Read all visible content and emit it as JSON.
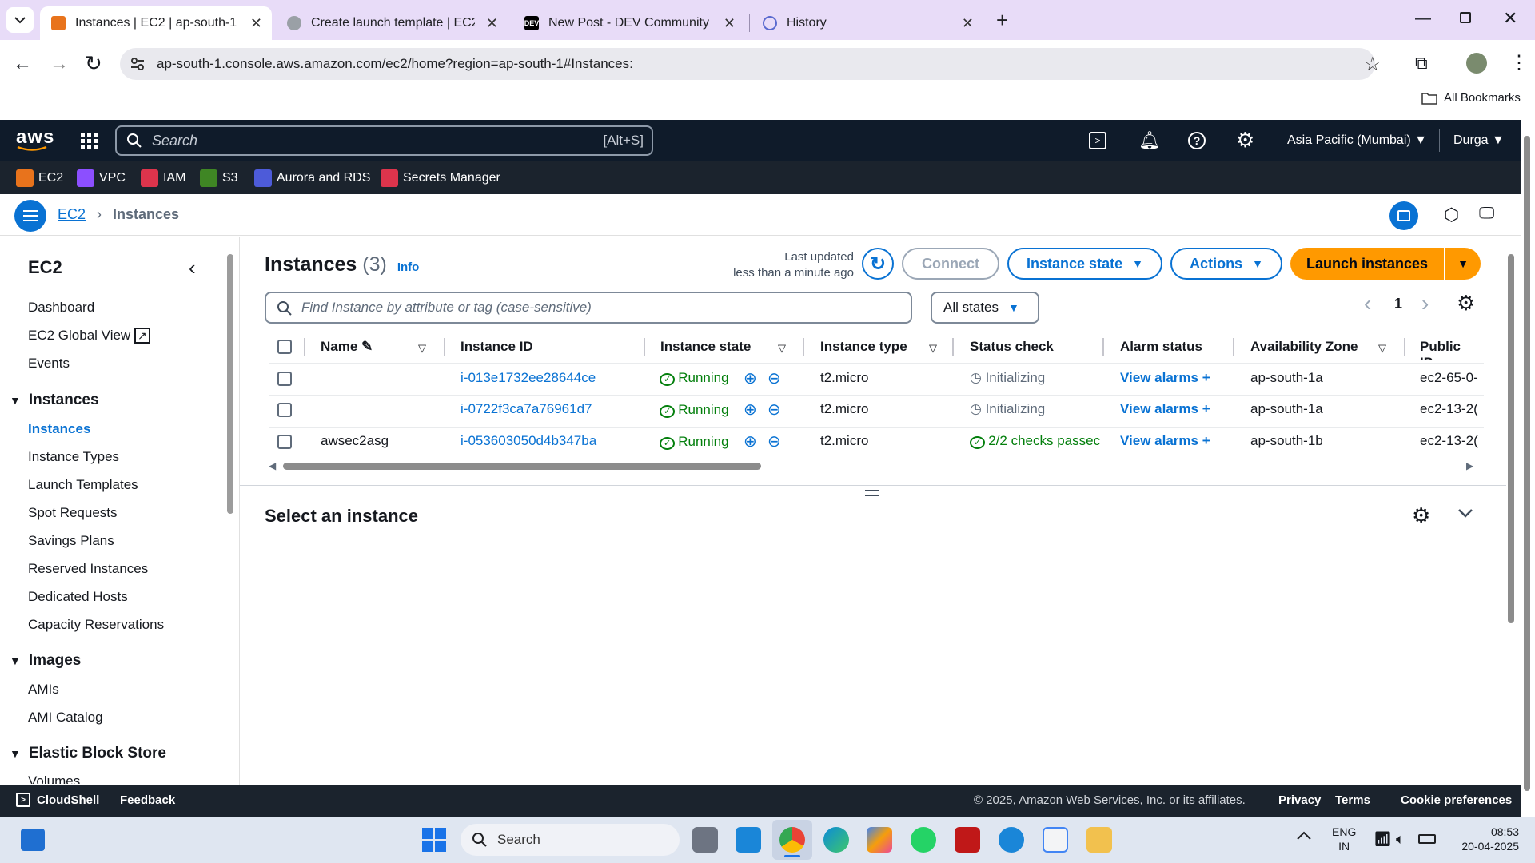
{
  "browser": {
    "tabs": [
      {
        "title": "Instances | EC2 | ap-south-1"
      },
      {
        "title": "Create launch template | EC2 | a"
      },
      {
        "title": "New Post - DEV Community"
      },
      {
        "title": "History"
      }
    ],
    "url": "ap-south-1.console.aws.amazon.com/ec2/home?region=ap-south-1#Instances:",
    "bookmarks_label": "All Bookmarks",
    "dev_badge": "DEV"
  },
  "aws_nav": {
    "logo": "aws",
    "search_placeholder": "Search",
    "search_shortcut": "[Alt+S]",
    "region": "Asia Pacific (Mumbai)",
    "user": "Durga",
    "favorites": [
      {
        "label": "EC2",
        "color": "#e8731c"
      },
      {
        "label": "VPC",
        "color": "#8c4fff"
      },
      {
        "label": "IAM",
        "color": "#dd344c"
      },
      {
        "label": "S3",
        "color": "#3f8624"
      },
      {
        "label": "Aurora and RDS",
        "color": "#4d5bd9"
      },
      {
        "label": "Secrets Manager",
        "color": "#dd344c"
      }
    ]
  },
  "breadcrumb": {
    "root": "EC2",
    "current": "Instances"
  },
  "sidebar": {
    "title": "EC2",
    "top_links": [
      "Dashboard",
      "EC2 Global View",
      "Events"
    ],
    "sections": [
      {
        "title": "Instances",
        "items": [
          "Instances",
          "Instance Types",
          "Launch Templates",
          "Spot Requests",
          "Savings Plans",
          "Reserved Instances",
          "Dedicated Hosts",
          "Capacity Reservations"
        ]
      },
      {
        "title": "Images",
        "items": [
          "AMIs",
          "AMI Catalog"
        ]
      },
      {
        "title": "Elastic Block Store",
        "items": [
          "Volumes"
        ]
      }
    ]
  },
  "main": {
    "title": "Instances",
    "count": "(3)",
    "info": "Info",
    "last_updated_1": "Last updated",
    "last_updated_2": "less than a minute ago",
    "buttons": {
      "connect": "Connect",
      "instance_state": "Instance state",
      "actions": "Actions",
      "launch": "Launch instances"
    },
    "filter_placeholder": "Find Instance by attribute or tag (case-sensitive)",
    "states_filter": "All states",
    "page": "1",
    "columns": [
      "Name",
      "Instance ID",
      "Instance state",
      "Instance type",
      "Status check",
      "Alarm status",
      "Availability Zone",
      "Public IPv"
    ],
    "rows": [
      {
        "name": "",
        "id": "i-013e1732ee28644ce",
        "state": "Running",
        "type": "t2.micro",
        "status": "Initializing",
        "alarm": "View alarms",
        "az": "ap-south-1a",
        "public": "ec2-65-0-"
      },
      {
        "name": "",
        "id": "i-0722f3ca7a76961d7",
        "state": "Running",
        "type": "t2.micro",
        "status": "Initializing",
        "alarm": "View alarms",
        "az": "ap-south-1a",
        "public": "ec2-13-2("
      },
      {
        "name": "awsec2asg",
        "id": "i-053603050d4b347ba",
        "state": "Running",
        "type": "t2.micro",
        "status": "2/2 checks passec",
        "alarm": "View alarms",
        "az": "ap-south-1b",
        "public": "ec2-13-2("
      }
    ],
    "details_title": "Select an instance"
  },
  "footer": {
    "cloudshell": "CloudShell",
    "feedback": "Feedback",
    "copyright": "© 2025, Amazon Web Services, Inc. or its affiliates.",
    "privacy": "Privacy",
    "terms": "Terms",
    "cookies": "Cookie preferences"
  },
  "taskbar": {
    "search": "Search",
    "lang1": "ENG",
    "lang2": "IN",
    "time": "08:53",
    "date": "20-04-2025"
  }
}
